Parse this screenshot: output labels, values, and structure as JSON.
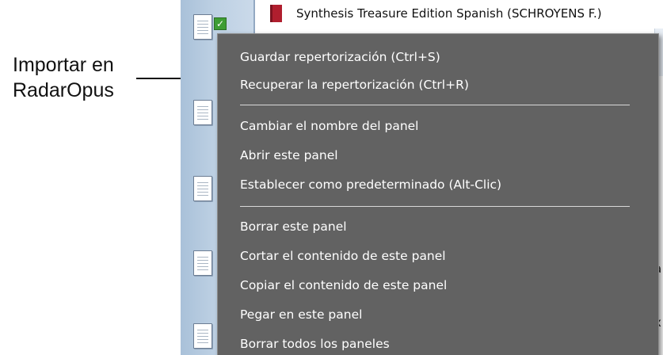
{
  "annotation": {
    "line1": "Importar en",
    "line2": "RadarOpus"
  },
  "background_window": {
    "book_title": "Synthesis Treasure Edition Spanish (SCHROYENS F.)",
    "edge_chars": [
      "a",
      "x"
    ],
    "colors": {
      "sidebar": "#bdd0e3",
      "book_icon": "#b01e2e",
      "check": "#3e9d34"
    },
    "icons": [
      "document-icon",
      "checkbox-checked-icon",
      "book-icon"
    ]
  },
  "context_menu": {
    "background": "#626262",
    "items": [
      "Guardar repertorización (Ctrl+S)",
      "Recuperar la repertorización (Ctrl+R)",
      "Cambiar el nombre del panel",
      "Abrir este panel",
      "Establecer como predeterminado (Alt-Clic)",
      "Borrar este panel",
      "Cortar el contenido de este panel",
      "Copiar el contenido de este panel",
      "Pegar en este panel",
      "Borrar todos los paneles"
    ]
  }
}
